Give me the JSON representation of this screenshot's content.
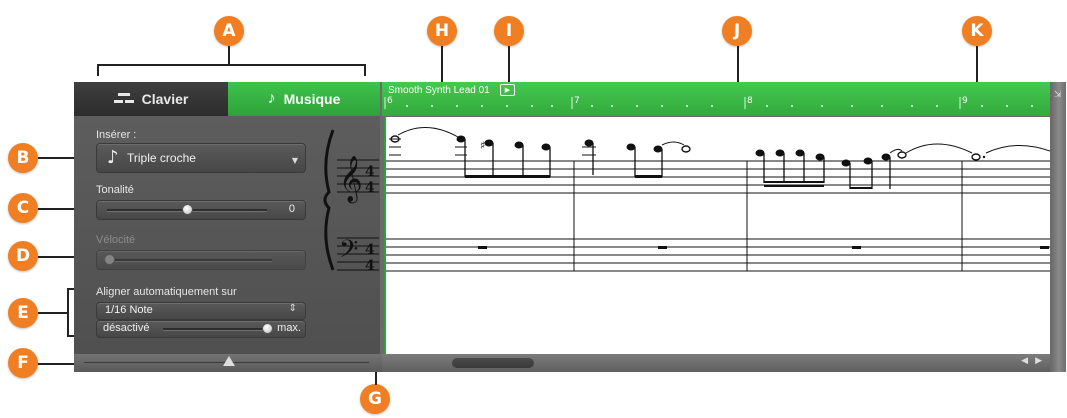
{
  "callouts": {
    "a": "A",
    "b": "B",
    "c": "C",
    "d": "D",
    "e": "E",
    "f": "F",
    "g": "G",
    "h": "H",
    "i": "I",
    "j": "J",
    "k": "K"
  },
  "tabs": {
    "clavier": "Clavier",
    "musique": "Musique"
  },
  "left_panel": {
    "inserer_label": "Insérer :",
    "inserer_value": "Triple croche",
    "tonalite_label": "Tonalité",
    "tonalite_value": "0",
    "velocite_label": "Vélocité",
    "aligner_label": "Aligner automatiquement sur",
    "aligner_value": "1/16 Note",
    "aligner_min": "désactivé",
    "aligner_max": "max."
  },
  "region": {
    "name": "Smooth Synth Lead 01"
  },
  "ruler": {
    "marks": [
      "6",
      "7",
      "8",
      "9"
    ]
  },
  "colors": {
    "accent": "#f07f24",
    "green": "#37b341",
    "panel": "#555555"
  },
  "icons": {
    "clavier": "keyboard-icon",
    "musique": "music-note-icon",
    "play": "play-icon",
    "note": "eighth-note-icon"
  }
}
